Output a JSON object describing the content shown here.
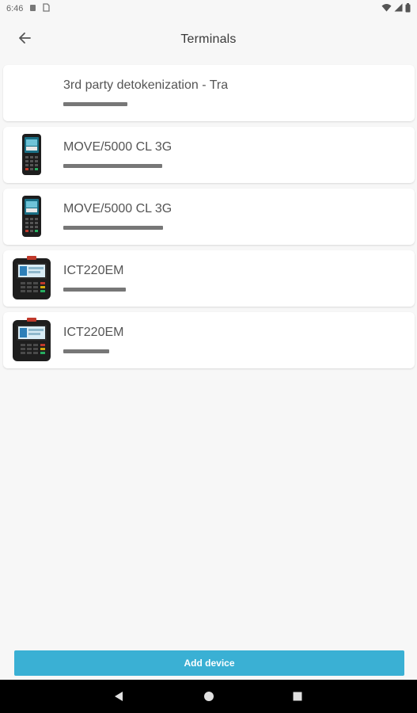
{
  "status_bar": {
    "time": "6:46",
    "left_icons": [
      "notification-icon",
      "sim-icon"
    ],
    "right_icons": [
      "wifi-icon",
      "signal-icon",
      "battery-icon"
    ]
  },
  "app_bar": {
    "title": "Terminals",
    "back_icon": "arrow-back-icon"
  },
  "terminals": [
    {
      "name": "3rd party detokenization - Tra",
      "image": "none",
      "redacted_fraction": 0.27
    },
    {
      "name": "MOVE/5000 CL 3G",
      "image": "move5000-terminal",
      "redacted_fraction": 0.42
    },
    {
      "name": "MOVE/5000 CL 3G",
      "image": "move5000-terminal",
      "redacted_fraction": 0.42
    },
    {
      "name": "ICT220EM",
      "image": "ict220-terminal",
      "redacted_fraction": 0.26
    },
    {
      "name": "ICT220EM",
      "image": "ict220-terminal",
      "redacted_fraction": 0.19
    }
  ],
  "actions": {
    "add_device_label": "Add device"
  },
  "navigation": {
    "buttons": [
      "back-triangle-icon",
      "home-circle-icon",
      "recents-square-icon"
    ]
  },
  "colors": {
    "accent": "#3ab0d4",
    "background": "#f7f7f7",
    "card": "#ffffff",
    "nav_bar": "#000000"
  }
}
